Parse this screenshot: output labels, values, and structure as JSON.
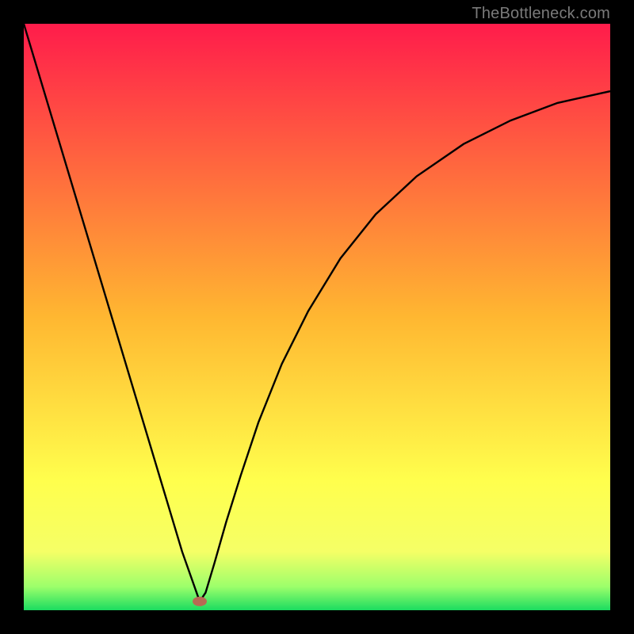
{
  "watermark": "TheBottleneck.com",
  "chart_data": {
    "type": "line",
    "title": "",
    "xlabel": "",
    "ylabel": "",
    "xlim": [
      0,
      1
    ],
    "ylim": [
      0,
      1
    ],
    "grid": false,
    "background_gradient": [
      {
        "stop": 0.0,
        "color": "#ff1c4b"
      },
      {
        "stop": 0.5,
        "color": "#ffb731"
      },
      {
        "stop": 0.78,
        "color": "#ffff4d"
      },
      {
        "stop": 0.9,
        "color": "#f5ff66"
      },
      {
        "stop": 0.96,
        "color": "#9cff6b"
      },
      {
        "stop": 1.0,
        "color": "#1bdc60"
      }
    ],
    "marker": {
      "x": 0.3,
      "y": 0.015,
      "color": "#b86a53"
    },
    "series": [
      {
        "name": "curve",
        "color": "#000000",
        "points": [
          {
            "x": 0.0,
            "y": 1.0
          },
          {
            "x": 0.03,
            "y": 0.9
          },
          {
            "x": 0.06,
            "y": 0.8
          },
          {
            "x": 0.09,
            "y": 0.7
          },
          {
            "x": 0.12,
            "y": 0.6
          },
          {
            "x": 0.15,
            "y": 0.5
          },
          {
            "x": 0.18,
            "y": 0.4
          },
          {
            "x": 0.21,
            "y": 0.3
          },
          {
            "x": 0.24,
            "y": 0.2
          },
          {
            "x": 0.27,
            "y": 0.1
          },
          {
            "x": 0.3,
            "y": 0.015
          },
          {
            "x": 0.31,
            "y": 0.03
          },
          {
            "x": 0.325,
            "y": 0.08
          },
          {
            "x": 0.345,
            "y": 0.15
          },
          {
            "x": 0.37,
            "y": 0.23
          },
          {
            "x": 0.4,
            "y": 0.32
          },
          {
            "x": 0.44,
            "y": 0.42
          },
          {
            "x": 0.485,
            "y": 0.51
          },
          {
            "x": 0.54,
            "y": 0.6
          },
          {
            "x": 0.6,
            "y": 0.675
          },
          {
            "x": 0.67,
            "y": 0.74
          },
          {
            "x": 0.75,
            "y": 0.795
          },
          {
            "x": 0.83,
            "y": 0.835
          },
          {
            "x": 0.91,
            "y": 0.865
          },
          {
            "x": 1.0,
            "y": 0.885
          }
        ]
      }
    ]
  }
}
